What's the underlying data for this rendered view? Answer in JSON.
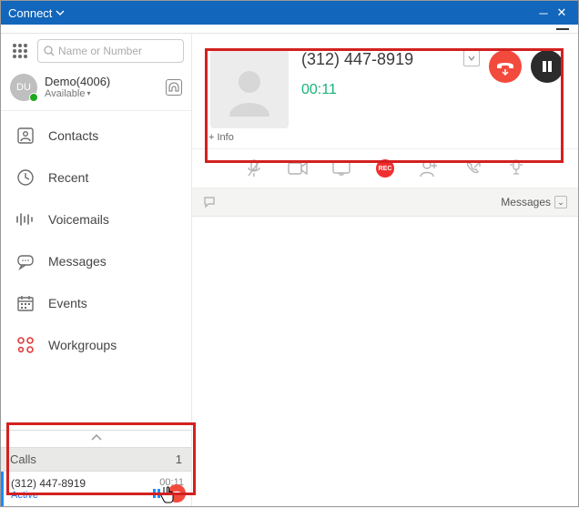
{
  "titlebar": {
    "title": "Connect"
  },
  "search": {
    "placeholder": "Name or Number"
  },
  "user": {
    "initials": "DU",
    "name": "Demo(4006)",
    "status": "Available"
  },
  "nav": {
    "contacts": "Contacts",
    "recent": "Recent",
    "voicemails": "Voicemails",
    "messages": "Messages",
    "events": "Events",
    "workgroups": "Workgroups"
  },
  "calls_panel": {
    "header": "Calls",
    "count": "1",
    "item": {
      "number": "(312) 447-8919",
      "duration": "00:11",
      "status": "Active"
    }
  },
  "active_call": {
    "number": "(312) 447-8919",
    "timer": "00:11",
    "info_label": "+ Info"
  },
  "messages_strip": {
    "label": "Messages"
  }
}
